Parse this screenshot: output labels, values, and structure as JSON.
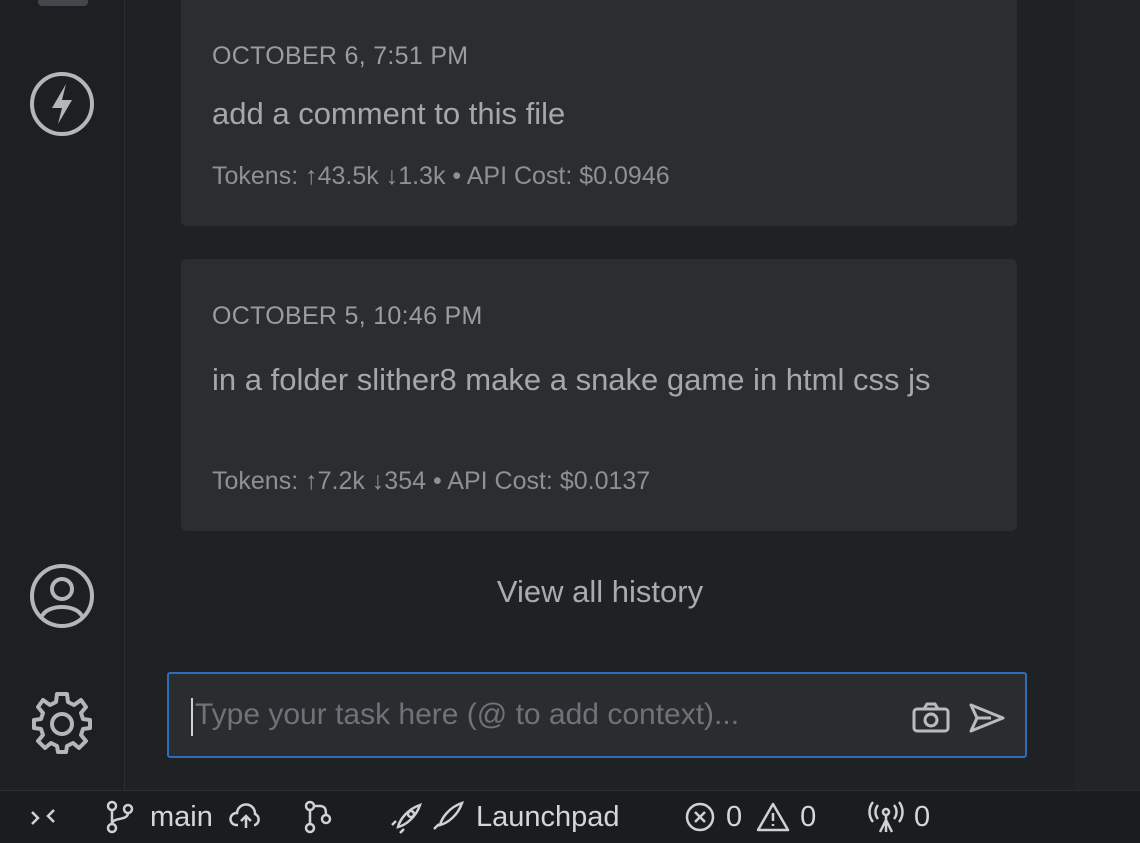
{
  "history": [
    {
      "date": "OCTOBER 6, 7:51 PM",
      "task": "add a comment to this file",
      "meta": "Tokens: ↑43.5k ↓1.3k • API Cost: $0.0946"
    },
    {
      "date": "OCTOBER 5, 10:46 PM",
      "task": "in a folder slither8 make a snake game in html css js",
      "meta": "Tokens: ↑7.2k ↓354 • API Cost: $0.0137"
    }
  ],
  "view_all_label": "View all history",
  "input": {
    "placeholder": "Type your task here (@ to add context)..."
  },
  "activity_bar": {
    "icons": [
      "lightning-icon",
      "account-icon",
      "settings-gear-icon"
    ]
  },
  "status_bar": {
    "branch": "main",
    "launchpad_label": "Launchpad",
    "errors": "0",
    "warnings": "0",
    "ports": "0"
  },
  "colors": {
    "accent_border": "#2f6dbb",
    "card_bg": "#2b2e31",
    "panel_bg": "#1f2124"
  }
}
